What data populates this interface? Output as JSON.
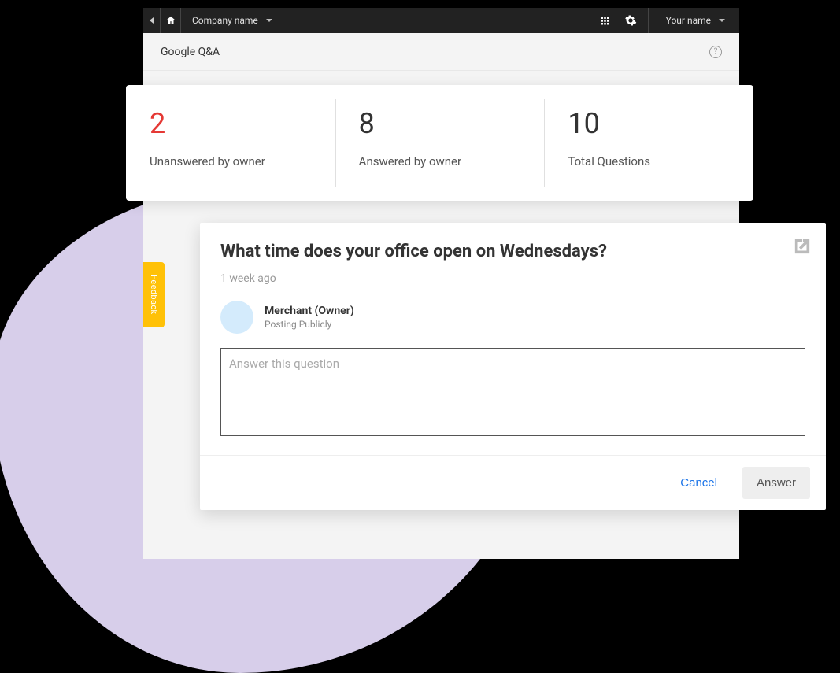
{
  "topbar": {
    "company_label": "Company name",
    "user_label": "Your name"
  },
  "page": {
    "title": "Google Q&A"
  },
  "feedback": {
    "label": "Feedback"
  },
  "stats": [
    {
      "value": "2",
      "label": "Unanswered by owner",
      "highlight": true
    },
    {
      "value": "8",
      "label": "Answered by owner",
      "highlight": false
    },
    {
      "value": "10",
      "label": "Total Questions",
      "highlight": false
    }
  ],
  "question": {
    "title": "What time does your office open on Wednesdays?",
    "time_ago": "1 week ago",
    "author_name": "Merchant (Owner)",
    "author_subtitle": "Posting Publicly",
    "answer_placeholder": "Answer this question",
    "cancel_label": "Cancel",
    "answer_label": "Answer"
  }
}
